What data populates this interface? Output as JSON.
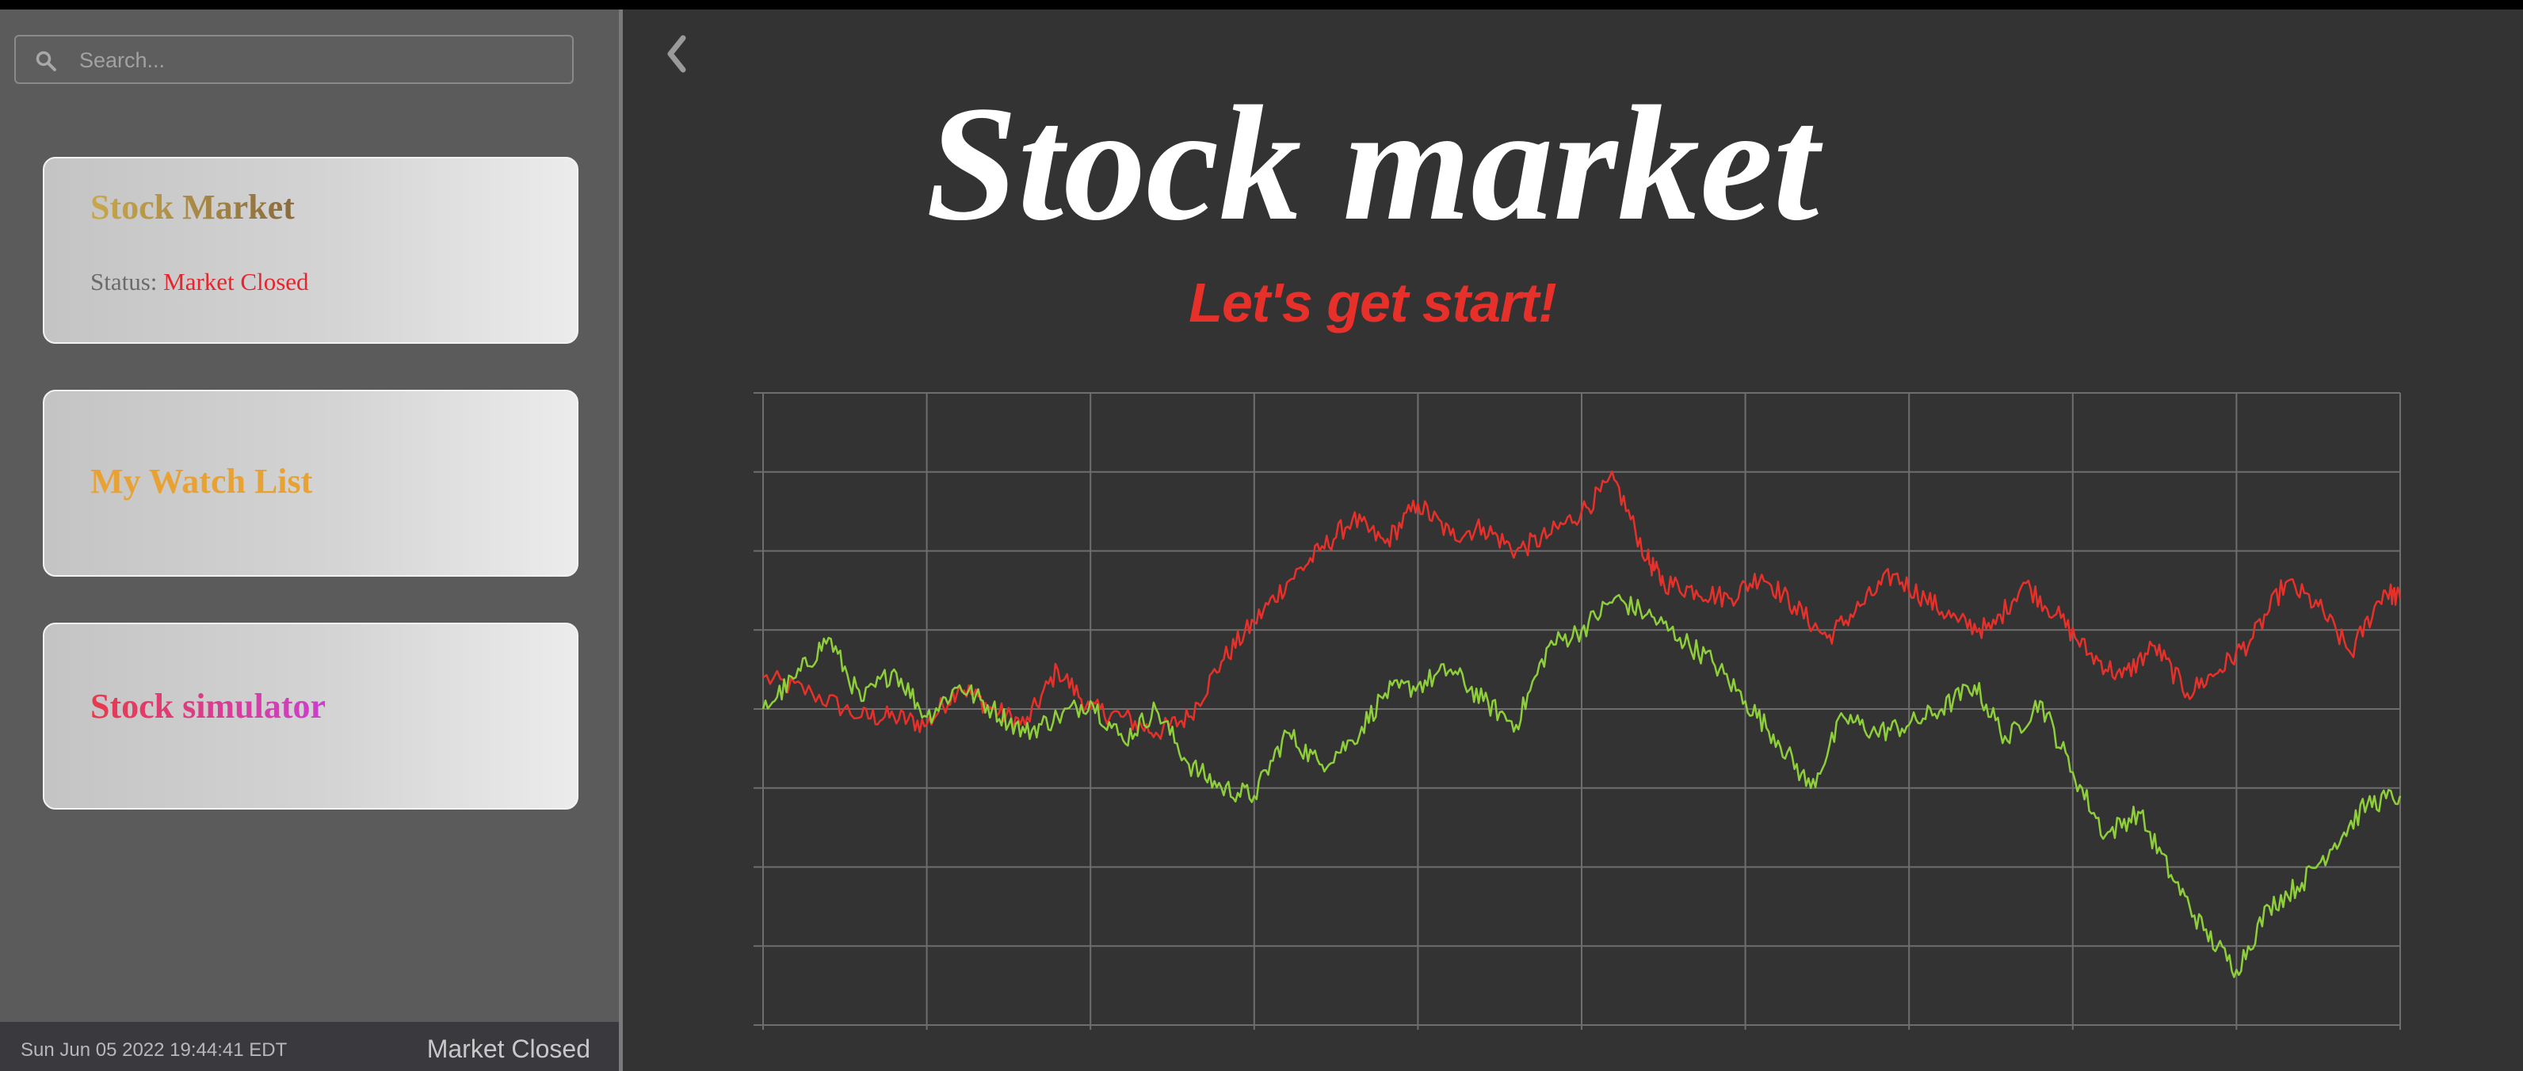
{
  "sidebar": {
    "search": {
      "placeholder": "Search..."
    },
    "cards": [
      {
        "title": "Stock Market",
        "status_label": "Status:",
        "status_value": "Market Closed"
      },
      {
        "title": "My Watch List"
      },
      {
        "title": "Stock simulator"
      }
    ],
    "footer": {
      "datetime": "Sun Jun 05 2022 19:44:41 EDT",
      "market_status": "Market Closed"
    }
  },
  "main": {
    "title": "Stock market",
    "subtitle": "Let's get start!"
  },
  "colors": {
    "background": "#333333",
    "sidebar": "#5b5b5b",
    "grid": "#6e6e6e",
    "status_closed": "#e8242d",
    "subtitle": "#e8302a",
    "watchlist_title": "#e8a233"
  },
  "icons": {
    "search": "search-icon",
    "back": "chevron-left-icon"
  },
  "chart_data": {
    "type": "line",
    "title": "",
    "xlabel": "",
    "ylabel": "",
    "xlim": [
      0,
      100
    ],
    "ylim": [
      0,
      8
    ],
    "grid": true,
    "series": [
      {
        "color": "#e8302a",
        "x": [
          0,
          3,
          6,
          8,
          10,
          12,
          14,
          16,
          18,
          20,
          22,
          24,
          26,
          28,
          30,
          32,
          34,
          36,
          38,
          40,
          42,
          44,
          46,
          48,
          50,
          52,
          54,
          55,
          57,
          59,
          61,
          63,
          65,
          67,
          69,
          71,
          73,
          75,
          77,
          79,
          81,
          83,
          85,
          87,
          89,
          91,
          93,
          95,
          97,
          99,
          100
        ],
        "y": [
          4.4,
          4.2,
          3.9,
          3.9,
          3.8,
          4.3,
          4.0,
          3.8,
          4.5,
          4.0,
          3.9,
          3.7,
          3.9,
          4.6,
          5.1,
          5.6,
          6.0,
          6.4,
          6.1,
          6.6,
          6.2,
          6.3,
          6.0,
          6.2,
          6.5,
          6.9,
          5.9,
          5.6,
          5.5,
          5.4,
          5.7,
          5.3,
          4.9,
          5.3,
          5.7,
          5.4,
          5.1,
          5.0,
          5.6,
          5.2,
          4.7,
          4.4,
          4.8,
          4.2,
          4.5,
          4.9,
          5.6,
          5.3,
          4.7,
          5.5,
          5.4
        ]
      },
      {
        "color": "#8dce3a",
        "x": [
          0,
          2,
          4,
          6,
          8,
          10,
          12,
          14,
          16,
          18,
          20,
          22,
          24,
          26,
          28,
          30,
          32,
          34,
          36,
          38,
          40,
          42,
          44,
          46,
          48,
          50,
          52,
          54,
          56,
          58,
          60,
          62,
          64,
          66,
          68,
          70,
          72,
          74,
          76,
          78,
          80,
          82,
          84,
          86,
          88,
          90,
          92,
          94,
          96,
          98,
          100
        ],
        "y": [
          4.0,
          4.4,
          4.9,
          4.1,
          4.5,
          3.9,
          4.3,
          4.0,
          3.7,
          3.9,
          4.1,
          3.6,
          4.0,
          3.3,
          3.0,
          2.9,
          3.7,
          3.3,
          3.6,
          4.2,
          4.3,
          4.5,
          4.1,
          3.8,
          4.8,
          5.0,
          5.4,
          5.2,
          4.9,
          4.6,
          4.1,
          3.6,
          3.0,
          3.9,
          3.7,
          3.8,
          4.0,
          4.3,
          3.6,
          4.1,
          3.2,
          2.4,
          2.7,
          1.9,
          1.2,
          0.7,
          1.5,
          1.8,
          2.3,
          2.8,
          2.9
        ]
      }
    ]
  }
}
